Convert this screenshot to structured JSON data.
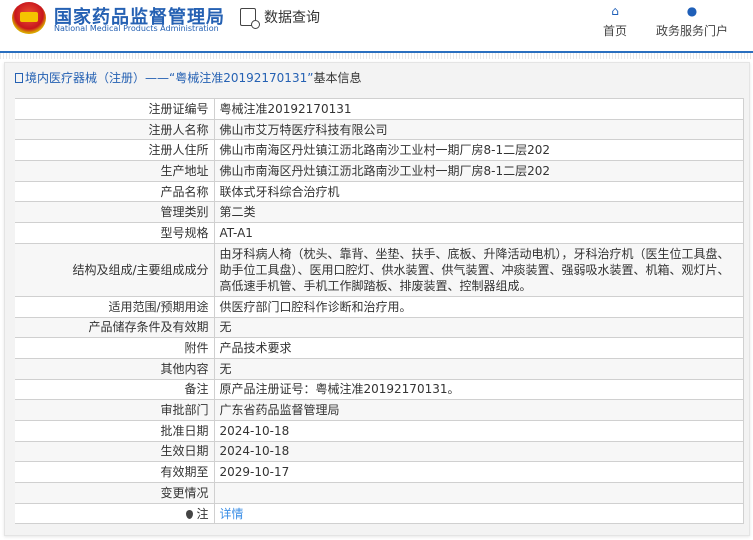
{
  "header": {
    "brand_cn": "国家药品监督管理局",
    "brand_en": "National Medical Products Administration",
    "query_label": "数据查询",
    "nav": [
      {
        "label": "首页",
        "icon": "home-icon"
      },
      {
        "label": "政务服务门户",
        "icon": "user-icon"
      }
    ]
  },
  "panel": {
    "title_prefix": "境内医疗器械（注册）——",
    "title_highlight": "“粤械注准20192170131”",
    "title_suffix": "基本信息"
  },
  "rows": [
    {
      "label": "注册证编号",
      "value": "粤械注准20192170131"
    },
    {
      "label": "注册人名称",
      "value": "佛山市艾万特医疗科技有限公司"
    },
    {
      "label": "注册人住所",
      "value": "佛山市南海区丹灶镇江沥北路南沙工业村一期厂房8-1二层202"
    },
    {
      "label": "生产地址",
      "value": "佛山市南海区丹灶镇江沥北路南沙工业村一期厂房8-1二层202"
    },
    {
      "label": "产品名称",
      "value": "联体式牙科综合治疗机"
    },
    {
      "label": "管理类别",
      "value": "第二类"
    },
    {
      "label": "型号规格",
      "value": "AT-A1"
    },
    {
      "label": "结构及组成/主要组成成分",
      "value": "由牙科病人椅（枕头、靠背、坐垫、扶手、底板、升降活动电机），牙科治疗机（医生位工具盘、助手位工具盘）、医用口腔灯、供水装置、供气装置、冲痰装置、强弱吸水装置、机箱、观灯片、高低速手机管、手机工作脚踏板、排废装置、控制器组成。"
    },
    {
      "label": "适用范围/预期用途",
      "value": "供医疗部门口腔科作诊断和治疗用。"
    },
    {
      "label": "产品储存条件及有效期",
      "value": "无"
    },
    {
      "label": "附件",
      "value": "产品技术要求"
    },
    {
      "label": "其他内容",
      "value": "无"
    },
    {
      "label": "备注",
      "value": "原产品注册证号：粤械注准20192170131。"
    },
    {
      "label": "审批部门",
      "value": "广东省药品监督管理局"
    },
    {
      "label": "批准日期",
      "value": "2024-10-18"
    },
    {
      "label": "生效日期",
      "value": "2024-10-18"
    },
    {
      "label": "有效期至",
      "value": "2029-10-17"
    },
    {
      "label": "变更情况",
      "value": ""
    },
    {
      "label": "注",
      "value": "详情"
    }
  ]
}
